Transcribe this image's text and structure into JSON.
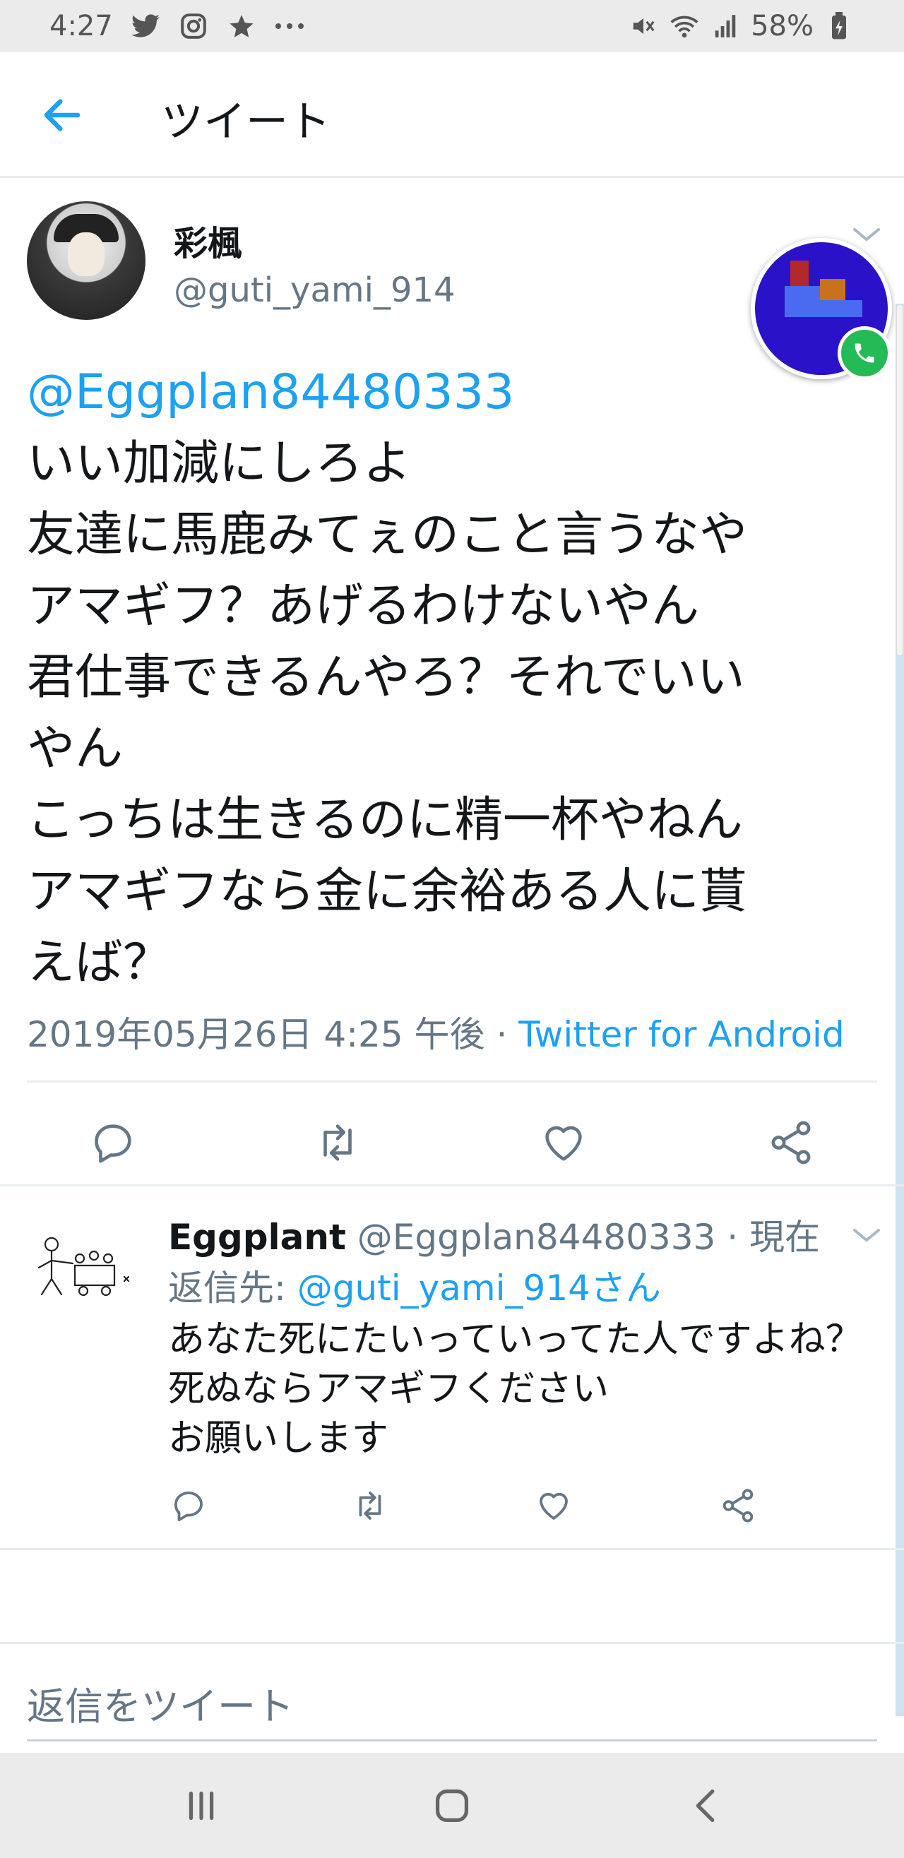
{
  "status_bar": {
    "time": "4:27",
    "battery": "58%",
    "icons": [
      "twitter-icon",
      "instagram-icon",
      "star-icon",
      "more-icon",
      "mute-icon",
      "wifi-icon",
      "signal-icon",
      "battery-icon"
    ]
  },
  "app_bar": {
    "title": "ツイート",
    "back_icon": "arrow-left-icon"
  },
  "main_tweet": {
    "display_name": "彩楓",
    "handle": "@guti_yami_914",
    "mention": "@Eggplan84480333",
    "body": "いい加減にしろよ\n友達に馬鹿みてぇのこと言うなや\nアマギフ？あげるわけないやん\n君仕事できるんやろ？それでいい\nやん\nこっちは生きるのに精一杯やねん\nアマギフなら金に余裕ある人に貰\nえば？",
    "timestamp": "2019年05月26日 4:25 午後 · ",
    "source": "Twitter for Android",
    "actions": [
      "reply-icon",
      "retweet-icon",
      "like-icon",
      "share-icon"
    ]
  },
  "reply": {
    "display_name": "Eggplant",
    "handle_time": " @Eggplan84480333 · 現在",
    "reply_to_label": "返信先: ",
    "reply_to_target": "@guti_yami_914さん",
    "body": "あなた死にたいっていってた人ですよね？\n死ぬならアマギフください\nお願いします"
  },
  "compose": {
    "placeholder": "返信をツイート"
  },
  "colors": {
    "accent": "#1da1f2",
    "secondary_text": "#657786",
    "primary_text": "#14171a",
    "divider": "#e6ecf0"
  }
}
